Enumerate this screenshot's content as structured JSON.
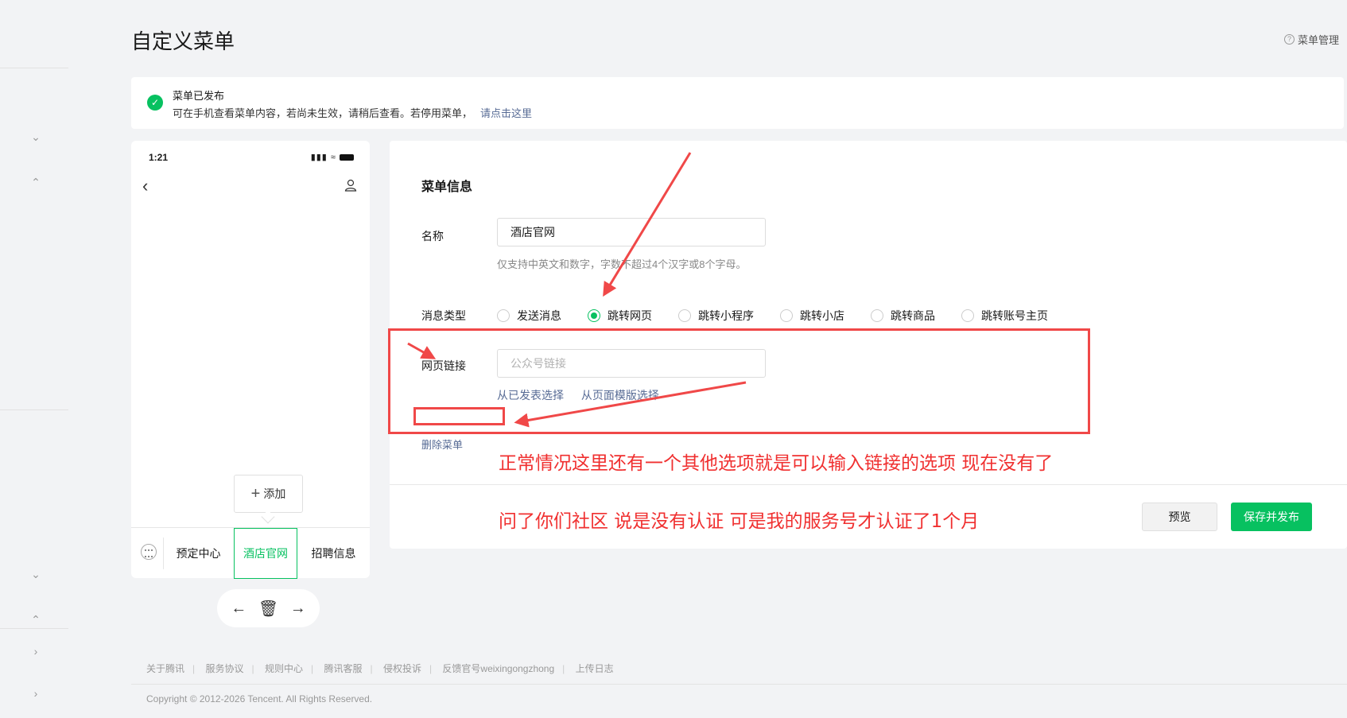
{
  "page": {
    "title": "自定义菜单",
    "menu_manage": "菜单管理"
  },
  "notice": {
    "title": "菜单已发布",
    "body": "可在手机查看菜单内容，若尚未生效，请稍后查看。若停用菜单，",
    "link": "请点击这里"
  },
  "phone": {
    "time": "1:21",
    "add_label": "添加",
    "menus": [
      "预定中心",
      "酒店官网",
      "招聘信息"
    ],
    "active_menu": "酒店官网"
  },
  "panel": {
    "heading": "菜单信息",
    "name_label": "名称",
    "name_value": "酒店官网",
    "name_hint": "仅支持中英文和数字，字数不超过4个汉字或8个字母。",
    "type_label": "消息类型",
    "types": [
      "发送消息",
      "跳转网页",
      "跳转小程序",
      "跳转小店",
      "跳转商品",
      "跳转账号主页"
    ],
    "selected_type": "跳转网页",
    "url_label": "网页链接",
    "url_placeholder": "公众号链接",
    "choose_published": "从已发表选择",
    "choose_template": "从页面模版选择",
    "delete_menu": "删除菜单",
    "preview_btn": "预览",
    "save_btn": "保存并发布"
  },
  "annotations": {
    "line1": "正常情况这里还有一个其他选项就是可以输入链接的选项 现在没有了",
    "line2": "问了你们社区 说是没有认证 可是我的服务号才认证了1个月",
    "color": "#f03030"
  },
  "footer": {
    "links": [
      "关于腾讯",
      "服务协议",
      "规则中心",
      "腾讯客服",
      "侵权投诉",
      "反馈官号weixingongzhong",
      "上传日志"
    ],
    "copyright": "Copyright © 2012-2026 Tencent. All Rights Reserved."
  },
  "colors": {
    "brand_green": "#07c160",
    "link_blue": "#576b95",
    "annotation_red": "#f04848"
  }
}
